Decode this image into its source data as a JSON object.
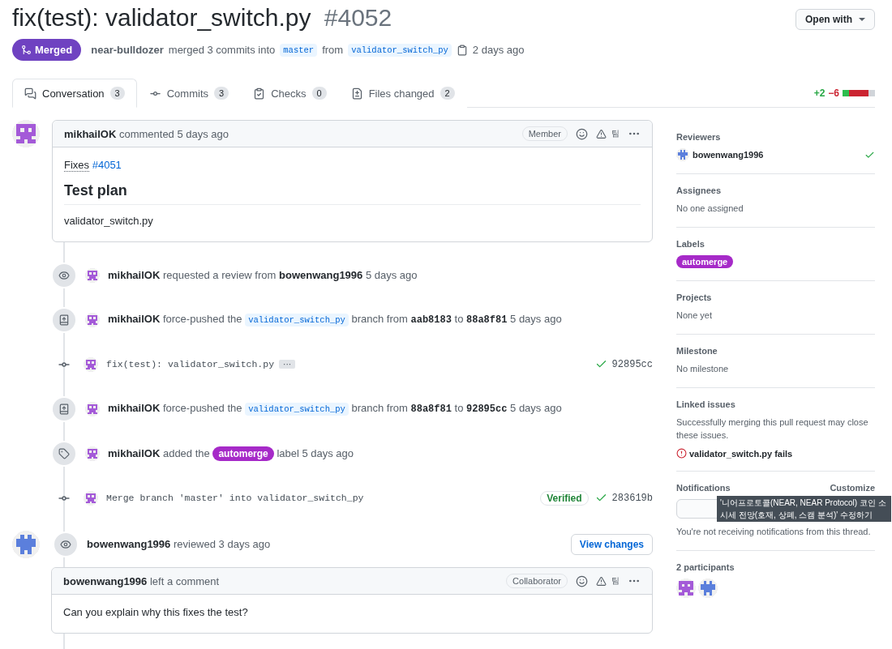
{
  "header": {
    "title": "fix(test): validator_switch.py",
    "number": "#4052",
    "open_with": "Open with",
    "state": {
      "kind": "merged",
      "label": "Merged"
    },
    "meta": {
      "author": "near-bulldozer",
      "action": "merged 3 commits into",
      "base": "master",
      "from": "from",
      "head": "validator_switch_py",
      "time": "2 days ago"
    }
  },
  "tabs": [
    {
      "label": "Conversation",
      "count": "3",
      "selected": true
    },
    {
      "label": "Commits",
      "count": "3",
      "selected": false
    },
    {
      "label": "Checks",
      "count": "0",
      "selected": false
    },
    {
      "label": "Files changed",
      "count": "2",
      "selected": false
    }
  ],
  "diffstat": {
    "added": "+2",
    "removed": "−6",
    "blocks": [
      {
        "color": "#2cbe4e"
      },
      {
        "color": "#cb2431"
      },
      {
        "color": "#cb2431"
      },
      {
        "color": "#cb2431"
      },
      {
        "color": "#d1d5da"
      }
    ]
  },
  "timeline": [
    {
      "kind": "comment",
      "avatar": {
        "kind": "face",
        "color": "#a45ad8"
      },
      "author": "mikhailOK",
      "meta": "commented 5 days ago",
      "badge": "Member",
      "tool_label": "팀",
      "body": [
        {
          "kind": "paragraph",
          "text": "Fixes",
          "link": "#4051"
        },
        {
          "kind": "heading",
          "text": "Test plan"
        },
        {
          "kind": "paragraph",
          "text": "validator_switch.py"
        }
      ]
    },
    {
      "kind": "review_requested",
      "avatar": {
        "kind": "face",
        "color": "#a45ad8"
      },
      "segments": [
        {
          "kind": "strong",
          "text": "mikhailOK"
        },
        {
          "kind": "text",
          "text": "requested a review from"
        },
        {
          "kind": "strong",
          "text": "bowenwang1996"
        },
        {
          "kind": "text",
          "text": "5 days ago"
        }
      ]
    },
    {
      "kind": "force_pushed",
      "avatar": {
        "kind": "face",
        "color": "#a45ad8"
      },
      "segments": [
        {
          "kind": "strong",
          "text": "mikhailOK"
        },
        {
          "kind": "text",
          "text": "force-pushed the"
        },
        {
          "kind": "branch",
          "text": "validator_switch_py"
        },
        {
          "kind": "text",
          "text": "branch from"
        },
        {
          "kind": "sha",
          "text": "aab8183"
        },
        {
          "kind": "text",
          "text": "to"
        },
        {
          "kind": "sha",
          "text": "88a8f81"
        },
        {
          "kind": "text",
          "text": "5 days ago"
        }
      ]
    },
    {
      "kind": "commit",
      "avatar": {
        "kind": "face",
        "color": "#a45ad8"
      },
      "message": "fix(test): validator_switch.py",
      "more": "···",
      "sha": "92895cc",
      "passed": true
    },
    {
      "kind": "force_pushed",
      "avatar": {
        "kind": "face",
        "color": "#a45ad8"
      },
      "segments": [
        {
          "kind": "strong",
          "text": "mikhailOK"
        },
        {
          "kind": "text",
          "text": "force-pushed the"
        },
        {
          "kind": "branch",
          "text": "validator_switch_py"
        },
        {
          "kind": "text",
          "text": "branch from"
        },
        {
          "kind": "sha",
          "text": "88a8f81"
        },
        {
          "kind": "text",
          "text": "to"
        },
        {
          "kind": "sha",
          "text": "92895cc"
        },
        {
          "kind": "text",
          "text": "5 days ago"
        }
      ]
    },
    {
      "kind": "labeled",
      "avatar": {
        "kind": "face",
        "color": "#a45ad8"
      },
      "segments": [
        {
          "kind": "strong",
          "text": "mikhailOK"
        },
        {
          "kind": "text",
          "text": "added the"
        },
        {
          "kind": "label",
          "text": "automerge",
          "color": "#a62ac8"
        },
        {
          "kind": "text",
          "text": "label 5 days ago"
        }
      ]
    },
    {
      "kind": "commit",
      "avatar": {
        "kind": "face",
        "color": "#a45ad8"
      },
      "message": "Merge branch 'master' into validator_switch_py",
      "verified": "Verified",
      "sha": "283619b",
      "passed": true
    },
    {
      "kind": "review",
      "avatar": {
        "kind": "robot",
        "color": "#5b7fdc"
      },
      "author": "bowenwang1996",
      "meta": "reviewed 3 days ago",
      "button": "View changes",
      "comment": {
        "author": "bowenwang1996",
        "meta": "left a comment",
        "badge": "Collaborator",
        "tool_label": "팀",
        "text": "Can you explain why this fixes the test?"
      }
    }
  ],
  "sidebar": [
    {
      "kind": "reviewers",
      "title": "Reviewers",
      "items": [
        {
          "name": "bowenwang1996",
          "avatar": {
            "kind": "robot",
            "color": "#5b7fdc"
          },
          "approved": true
        }
      ]
    },
    {
      "kind": "text",
      "title": "Assignees",
      "text": "No one assigned"
    },
    {
      "kind": "labels",
      "title": "Labels",
      "items": [
        {
          "text": "automerge",
          "color": "#a62ac8"
        }
      ]
    },
    {
      "kind": "text",
      "title": "Projects",
      "text": "None yet"
    },
    {
      "kind": "text",
      "title": "Milestone",
      "text": "No milestone"
    },
    {
      "kind": "linked",
      "title": "Linked issues",
      "text": "Successfully merging this pull request may close these issues.",
      "issue": "validator_switch.py fails"
    },
    {
      "kind": "notifications",
      "title": "Notifications",
      "action": "Customize",
      "text": "You're not receiving notifications from this thread.",
      "tooltip": [
        "'니어프로토콜(NEAR, NEAR Protocol) 코인 소",
        "시세 전망(호재, 상폐, 스캠 분석)' 수정하기"
      ]
    },
    {
      "kind": "participants",
      "title": "2 participants",
      "items": [
        {
          "avatar": {
            "kind": "face",
            "color": "#a45ad8"
          }
        },
        {
          "avatar": {
            "kind": "robot",
            "color": "#5b7fdc"
          }
        }
      ]
    }
  ]
}
